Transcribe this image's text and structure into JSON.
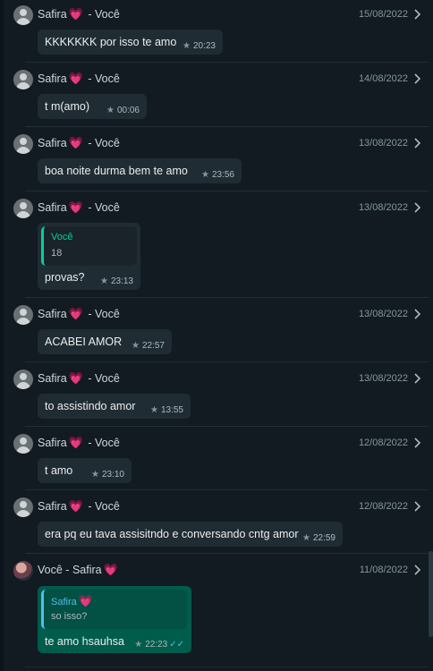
{
  "messages": [
    {
      "sender": "Safira",
      "heart": "💗",
      "separator": "-",
      "recipient": "Você",
      "date": "15/08/2022",
      "text": "KKKKKKK por isso te amo",
      "time": "20:23"
    },
    {
      "sender": "Safira",
      "heart": "💗",
      "separator": "-",
      "recipient": "Você",
      "date": "14/08/2022",
      "text": "t m(amo)",
      "time": "00:06"
    },
    {
      "sender": "Safira",
      "heart": "💗",
      "separator": "-",
      "recipient": "Você",
      "date": "13/08/2022",
      "text": "boa noite durma bem te amo",
      "time": "23:56"
    },
    {
      "sender": "Safira",
      "heart": "💗",
      "separator": "-",
      "recipient": "Você",
      "date": "13/08/2022",
      "quote_name": "Você",
      "quote_text": "18",
      "text": "provas?",
      "time": "23:13"
    },
    {
      "sender": "Safira",
      "heart": "💗",
      "separator": "-",
      "recipient": "Você",
      "date": "13/08/2022",
      "text": "ACABEI AMOR",
      "time": "22:57"
    },
    {
      "sender": "Safira",
      "heart": "💗",
      "separator": "-",
      "recipient": "Você",
      "date": "13/08/2022",
      "text": "to assistindo amor",
      "time": "13:55"
    },
    {
      "sender": "Safira",
      "heart": "💗",
      "separator": "-",
      "recipient": "Você",
      "date": "12/08/2022",
      "text": "t amo",
      "time": "23:10"
    },
    {
      "sender": "Safira",
      "heart": "💗",
      "separator": "-",
      "recipient": "Você",
      "date": "12/08/2022",
      "text": "era pq eu tava assisitndo e conversando cntg amor",
      "time": "22:59"
    },
    {
      "sender": "Você",
      "separator": "-",
      "recipient": "Safira",
      "recipient_heart": "💗",
      "date": "11/08/2022",
      "quote_name": "Safira",
      "quote_heart": "💗",
      "quote_text": "so isso?",
      "text": "te amo hsauhsa",
      "time": "22:23",
      "status": "read"
    }
  ],
  "icons": {
    "star": "star-icon",
    "chevron": "chevron-right-icon",
    "ticks": "double-check-icon",
    "avatar": "default-avatar-icon"
  },
  "colors": {
    "background": "#111b21",
    "incoming_bubble": "#202c33",
    "outgoing_bubble": "#005c4b",
    "quote_accent": "#06cf9c",
    "read_ticks": "#53bdeb"
  }
}
